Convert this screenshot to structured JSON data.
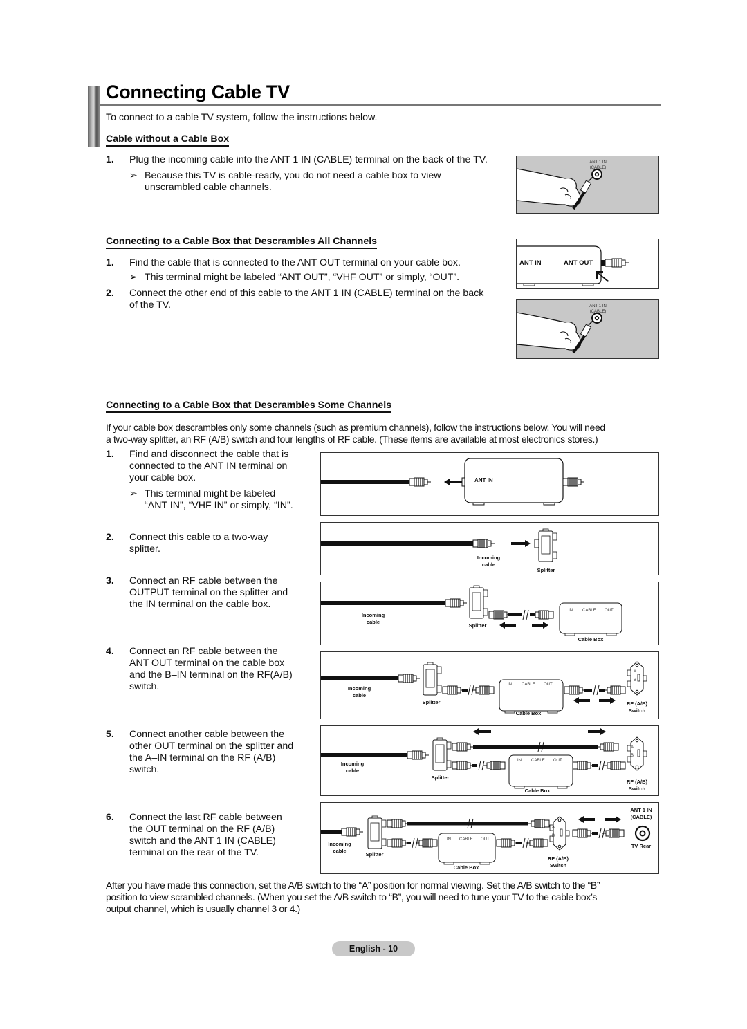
{
  "page": {
    "title": "Connecting Cable TV",
    "intro": "To connect to a cable TV system, follow the instructions below.",
    "page_label": "English - 10"
  },
  "section1": {
    "heading": "Cable without a Cable Box",
    "steps": [
      {
        "num": "1.",
        "text": "Plug the incoming cable into the ANT 1 IN (CABLE) terminal on the back of the TV."
      }
    ],
    "note_line1": "Because this TV is cable-ready, you do not need a cable box to view",
    "note_line2": "unscrambled cable channels.",
    "figure": {
      "label_line1": "ANT 1 IN",
      "label_line2": "(CABLE)"
    }
  },
  "section2": {
    "heading": "Connecting to a Cable Box that Descrambles All Channels",
    "steps": [
      {
        "num": "1.",
        "text": "Find the cable that is connected to the ANT OUT terminal on your cable box."
      },
      {
        "num": "2.",
        "text_line1": "Connect the other end of this cable to the ANT 1 IN (CABLE) terminal on the back",
        "text_line2": "of the TV."
      }
    ],
    "note": "This terminal might be labeled “ANT OUT”, “VHF OUT” or simply, “OUT”.",
    "figure_box": {
      "ant_in": "ANT IN",
      "ant_out": "ANT OUT"
    },
    "figure_tv": {
      "label_line1": "ANT 1 IN",
      "label_line2": "(CABLE)"
    }
  },
  "section3": {
    "heading": "Connecting to a Cable Box that Descrambles Some Channels",
    "intro_line1": "If your cable box descrambles only some channels (such as premium channels), follow the instructions below. You will need",
    "intro_line2": "a two-way splitter, an RF (A/B) switch and four lengths of RF cable. (These items are available at most electronics stores.)",
    "steps": [
      {
        "num": "1.",
        "lines": [
          "Find and disconnect the cable that is",
          "connected to the ANT IN terminal on",
          "your cable box."
        ]
      },
      {
        "num": "2.",
        "lines": [
          "Connect this cable to a two-way",
          "splitter."
        ]
      },
      {
        "num": "3.",
        "lines": [
          "Connect an RF cable between the",
          "OUTPUT terminal on the splitter and",
          "the IN terminal on the cable box."
        ]
      },
      {
        "num": "4.",
        "lines": [
          "Connect an RF cable between the",
          "ANT OUT terminal on the cable box",
          "and the B–IN terminal on the RF(A/B)",
          "switch."
        ]
      },
      {
        "num": "5.",
        "lines": [
          "Connect another cable between the",
          "other OUT terminal on the splitter and",
          "the A–IN terminal on the RF (A/B)",
          "switch."
        ]
      },
      {
        "num": "6.",
        "lines": [
          "Connect the last RF cable between",
          "the OUT terminal on the RF (A/B)",
          "switch and the ANT 1 IN (CABLE)",
          "terminal on the rear of the TV."
        ]
      }
    ],
    "step1_note_line1": "This terminal might be labeled",
    "step1_note_line2": "“ANT IN”, “VHF IN” or simply, “IN”.",
    "diagram_labels": {
      "ant_in": "ANT IN",
      "incoming": "Incoming",
      "cable": "cable",
      "splitter": "Splitter",
      "cable_box": "Cable Box",
      "box_in": "IN",
      "box_cable": "CABLE",
      "box_out": "OUT",
      "rf_ab": "RF (A/B)",
      "switch": "Switch",
      "sw_a": "A",
      "sw_b": "B",
      "tv_ant1": "ANT 1 IN",
      "tv_cable": "(CABLE)",
      "tv_rear": "TV Rear"
    },
    "outro_line1": "After you have made this connection, set the A/B switch to the “A” position for normal viewing. Set the A/B switch to the “B”",
    "outro_line2": "position to view scrambled channels. (When you set the A/B switch to “B”, you will need to tune your TV to the cable box’s",
    "outro_line3": "output channel, which is usually channel 3 or 4.)"
  }
}
